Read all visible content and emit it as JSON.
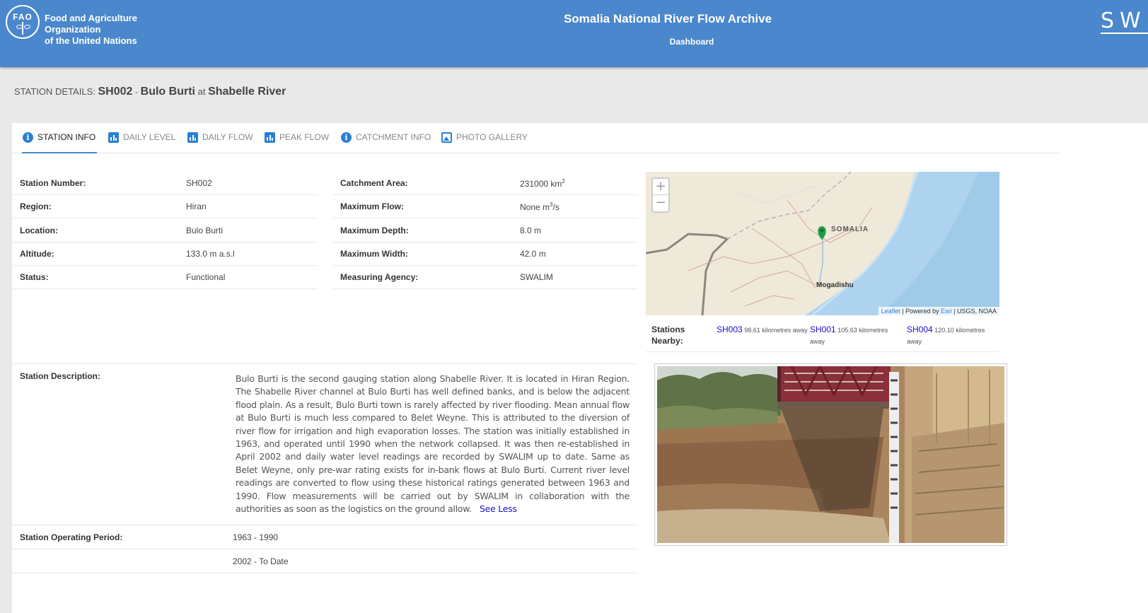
{
  "header": {
    "org_line1": "Food and Agriculture Organization",
    "org_line2": "of the United Nations",
    "logo_letters": "FAO",
    "app_title": "Somalia National River Flow Archive",
    "subtitle": "Dashboard",
    "right_logo": "SW"
  },
  "heading": {
    "prefix": "STATION DETAILS:",
    "station_id": "SH002",
    "sep": "-",
    "station_name": "Bulo Burti",
    "at": "at",
    "river": "Shabelle River"
  },
  "tabs": [
    {
      "label": "STATION INFO",
      "icon": "info-icon",
      "active": true
    },
    {
      "label": "DAILY LEVEL",
      "icon": "bar-chart-icon"
    },
    {
      "label": "DAILY FLOW",
      "icon": "bar-chart-icon"
    },
    {
      "label": "PEAK FLOW",
      "icon": "bar-chart-icon"
    },
    {
      "label": "CATCHMENT INFO",
      "icon": "info-icon"
    },
    {
      "label": "PHOTO GALLERY",
      "icon": "photo-icon"
    }
  ],
  "left_info": [
    {
      "label": "Station Number:",
      "value": "SH002"
    },
    {
      "label": "Region:",
      "value": "Hiran"
    },
    {
      "label": "Location:",
      "value": "Bulo Burti"
    },
    {
      "label": "Altitude:",
      "value": "133.0 m a.s.l"
    },
    {
      "label": "Status:",
      "value": "Functional"
    }
  ],
  "right_info": {
    "catchment_label": "Catchment Area:",
    "catchment_value": "231000 km",
    "catchment_sup": "2",
    "max_flow_label": "Maximum Flow:",
    "max_flow_value": "None m",
    "max_flow_sup": "3",
    "max_flow_unit": "/s",
    "max_depth_label": "Maximum Depth:",
    "max_depth_value": "8.0 m",
    "max_width_label": "Maximum Width:",
    "max_width_value": "42.0 m",
    "agency_label": "Measuring Agency:",
    "agency_value": "SWALIM"
  },
  "map": {
    "zoom_in": "+",
    "zoom_out": "−",
    "label_country": "SOMALIA",
    "label_city": "Mogadishu",
    "attribution_leaflet": "Leaflet",
    "attribution_mid": " | Powered by ",
    "attribution_esri": "Esri",
    "attribution_end": " | USGS, NOAA"
  },
  "nearby": {
    "label": "Stations Nearby:",
    "stations": [
      {
        "id": "SH003",
        "distance": "98.61 kilometres away"
      },
      {
        "id": "SH001",
        "distance": "105.63 kilometres away"
      },
      {
        "id": "SH004",
        "distance": "120.10 kilometres away"
      }
    ]
  },
  "description": {
    "label": "Station Description:",
    "text": "Bulo Burti is the second gauging station along Shabelle River. It is located in Hiran Region. The Shabelle River channel at Bulo Burti has well defined banks, and is below the adjacent flood plain. As a result, Bulo Burti town is rarely affected by river flooding. Mean annual flow at Bulo Burti is much less compared to Belet Weyne. This is attributed to the diversion of river flow for irrigation and high evaporation losses. The station was initially established in 1963, and operated until 1990 when the network collapsed. It was then re-established in April 2002 and daily water level readings are recorded by SWALIM up to date. Same as Belet Weyne, only pre-war rating exists for in-bank flows at Bulo Burti. Current river level readings are converted to flow using these historical ratings generated between 1963 and 1990. Flow measurements will be carried out by SWALIM in collaboration with the authorities as soon as the logistics on the ground allow.",
    "toggle": "See Less"
  },
  "operating": {
    "label": "Station Operating Period:",
    "periods": [
      "1963 - 1990",
      "2002 - To Date"
    ]
  },
  "colors": {
    "header": "#4a87cc",
    "accent": "#2a7fd4",
    "link": "#1a0dcc"
  }
}
